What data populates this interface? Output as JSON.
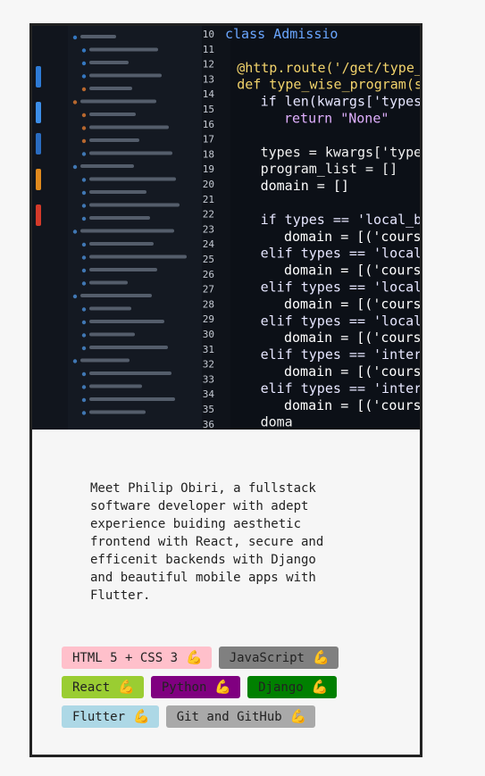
{
  "bio": "Meet Philip Obiri, a fullstack\nsoftware developer with adept\nexperience buiding aesthetic\nfrontend with React, secure and\nefficenit backends with Django\nand beautiful mobile apps with\nFlutter.",
  "skills": [
    {
      "label": "HTML 5 + CSS 3",
      "icon": "flexed-biceps-icon",
      "glyph": "💪",
      "color": "#ffc0cb"
    },
    {
      "label": "JavaScript",
      "icon": "flexed-biceps-icon",
      "glyph": "💪",
      "color": "#808080"
    },
    {
      "label": "React",
      "icon": "flexed-biceps-icon",
      "glyph": "💪",
      "color": "#9acd32"
    },
    {
      "label": "Python",
      "icon": "flexed-biceps-icon",
      "glyph": "💪",
      "color": "#800080"
    },
    {
      "label": "Django",
      "icon": "flexed-biceps-icon",
      "glyph": "💪",
      "color": "#008000"
    },
    {
      "label": "Flutter",
      "icon": "flexed-biceps-icon",
      "glyph": "💪",
      "color": "#add8e6"
    },
    {
      "label": "Git and GitHub",
      "icon": "flexed-biceps-icon",
      "glyph": "💪",
      "color": "#a9a9a9"
    }
  ],
  "hero": {
    "line_numbers": [
      "10",
      "11",
      "12",
      "13",
      "14",
      "15",
      "16",
      "17",
      "18",
      "19",
      "20",
      "21",
      "22",
      "23",
      "24",
      "25",
      "26",
      "27",
      "28",
      "29",
      "30",
      "31",
      "32",
      "33",
      "34",
      "35",
      "36"
    ],
    "code_lines": [
      "class Admissio",
      "",
      "  @http.route('/get/type_wise_p",
      "  def type_wise_program(self, *",
      "      if len(kwargs['types'])<=",
      "          return \"None\"",
      "",
      "      types = kwargs['types']",
      "      program_list = []",
      "      domain = []",
      "",
      "      if types == 'local_bache",
      "          domain = [('course_i",
      "      elif types == 'local_bacl",
      "          domain = [('course_i",
      "      elif types == 'local_bacl",
      "          domain = [('course_i",
      "      elif types == 'local_mast",
      "          domain = [('course_i",
      "      elif types == 'internati",
      "          domain = [('course_i",
      "      elif types == 'internati",
      "          domain = [('course_i",
      "      doma"
    ]
  }
}
